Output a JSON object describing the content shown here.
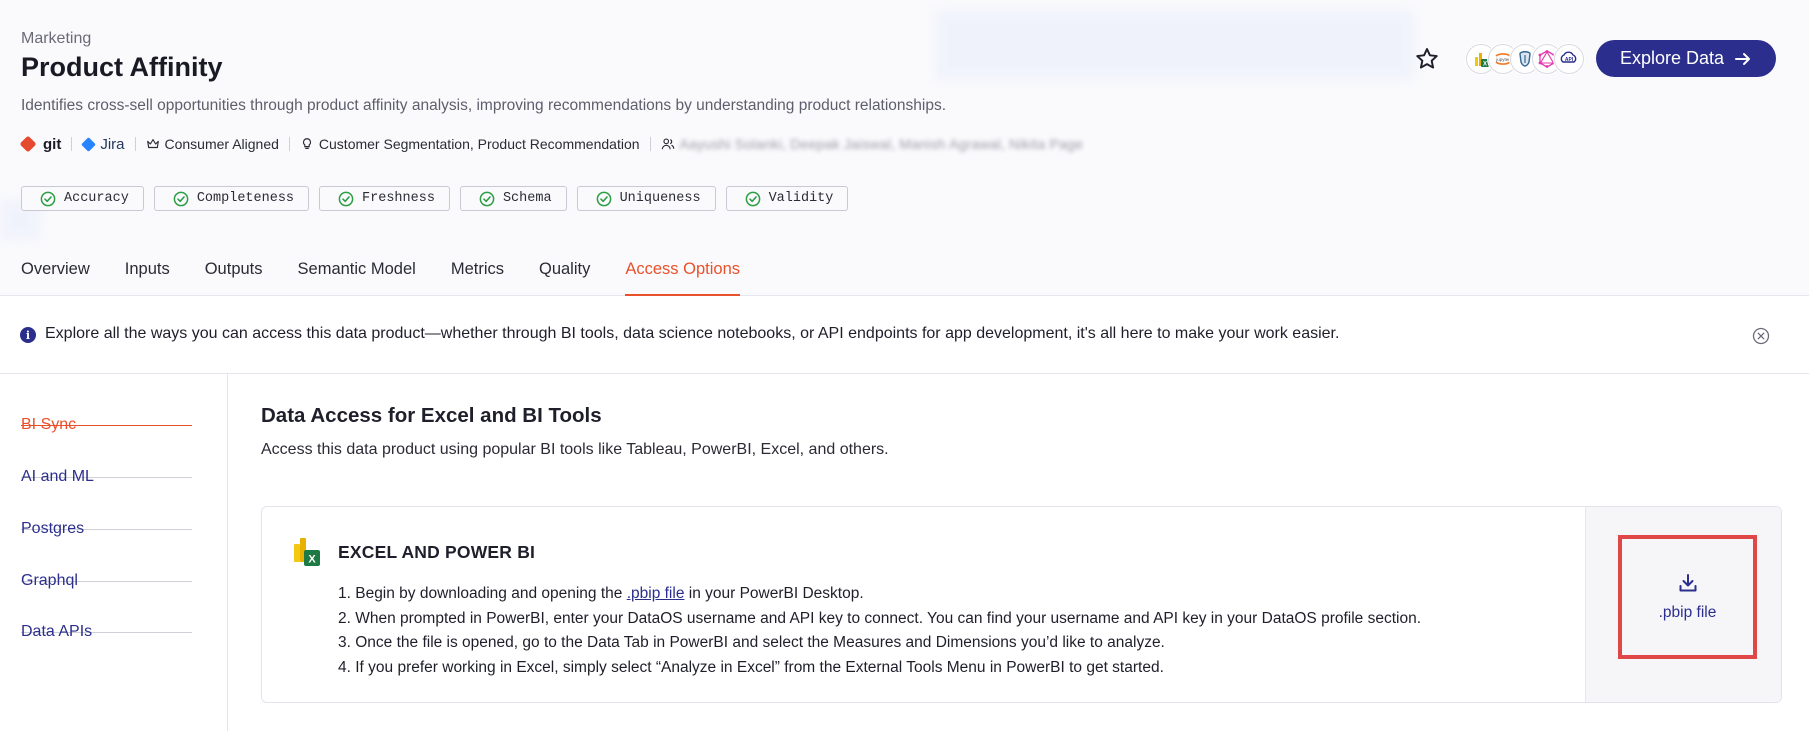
{
  "header": {
    "domain": "Marketing",
    "title": "Product Affinity",
    "description": "Identifies cross-sell opportunities through product affinity analysis, improving recommendations by understanding product relationships.",
    "meta": {
      "git": "git",
      "jira": "Jira",
      "alignment": "Consumer Aligned",
      "use_cases": "Customer Segmentation,  Product Recommendation",
      "owners": "Aayushi Solanki, Deepak Jaiswal, Manish Agrawal, Nikita Page"
    },
    "quality_checks": [
      "Accuracy",
      "Completeness",
      "Freshness",
      "Schema",
      "Uniqueness",
      "Validity"
    ],
    "explore_button": "Explore Data",
    "tool_icons": [
      "excel-powerbi-icon",
      "jupyter-icon",
      "postgres-icon",
      "graphql-icon",
      "data-api-icon"
    ],
    "tool_icon_labels": [
      "",
      "jupyter",
      "",
      "",
      "API"
    ]
  },
  "tabs": [
    "Overview",
    "Inputs",
    "Outputs",
    "Semantic Model",
    "Metrics",
    "Quality",
    "Access Options"
  ],
  "active_tab": "Access Options",
  "banner": {
    "text": "Explore all the ways you can access this data product—whether through BI tools, data science notebooks, or API endpoints for app development, it's all here to make your work easier."
  },
  "sidebar": {
    "items": [
      "BI Sync",
      "AI and ML",
      "Postgres",
      "Graphql",
      "Data APIs"
    ],
    "active": "BI Sync"
  },
  "main": {
    "title": "Data Access for Excel and BI Tools",
    "subtitle": "Access this data product using popular BI tools like Tableau, PowerBI, Excel, and others.",
    "card": {
      "title": "EXCEL AND POWER BI",
      "step1_prefix": "1. Begin by downloading and opening the ",
      "step1_link": ".pbip file",
      "step1_suffix": " in your PowerBI Desktop.",
      "step2": "2. When prompted in PowerBI, enter your DataOS username and API key to connect. You can find your username and API key in your DataOS profile section.",
      "step3": "3. Once the file is opened, go to the Data Tab in PowerBI and select the Measures and Dimensions you’d like to analyze.",
      "step4": "4. If you prefer working in Excel, simply select “Analyze in Excel” from the External Tools Menu in PowerBI to get started.",
      "download_label": ".pbip file"
    }
  },
  "colors": {
    "accent": "#e8512b",
    "primary": "#2b2e8c",
    "highlight_box": "#e04848"
  }
}
